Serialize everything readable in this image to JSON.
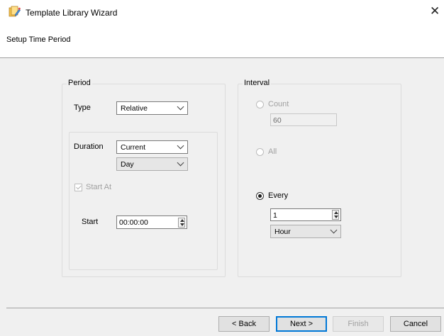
{
  "window": {
    "title": "Template Library Wizard",
    "close_glyph": "✕",
    "icon": "wizard-app-icon"
  },
  "header": {
    "step_title": "Setup Time Period"
  },
  "period": {
    "legend": "Period",
    "type_label": "Type",
    "type_value": "Relative",
    "duration_label": "Duration",
    "duration_value": "Current",
    "duration_unit_value": "Day",
    "start_at_label": "Start At",
    "start_at_checked": true,
    "start_label": "Start",
    "start_value": "00:00:00"
  },
  "interval": {
    "legend": "Interval",
    "count_label": "Count",
    "count_value": "60",
    "all_label": "All",
    "every_label": "Every",
    "every_selected": true,
    "every_value": "1",
    "every_unit_value": "Hour"
  },
  "footer": {
    "back_label": "< Back",
    "next_label": "Next >",
    "finish_label": "Finish",
    "cancel_label": "Cancel"
  },
  "colors": {
    "accent": "#0078d7",
    "panel_bg": "#f0f0f0"
  }
}
